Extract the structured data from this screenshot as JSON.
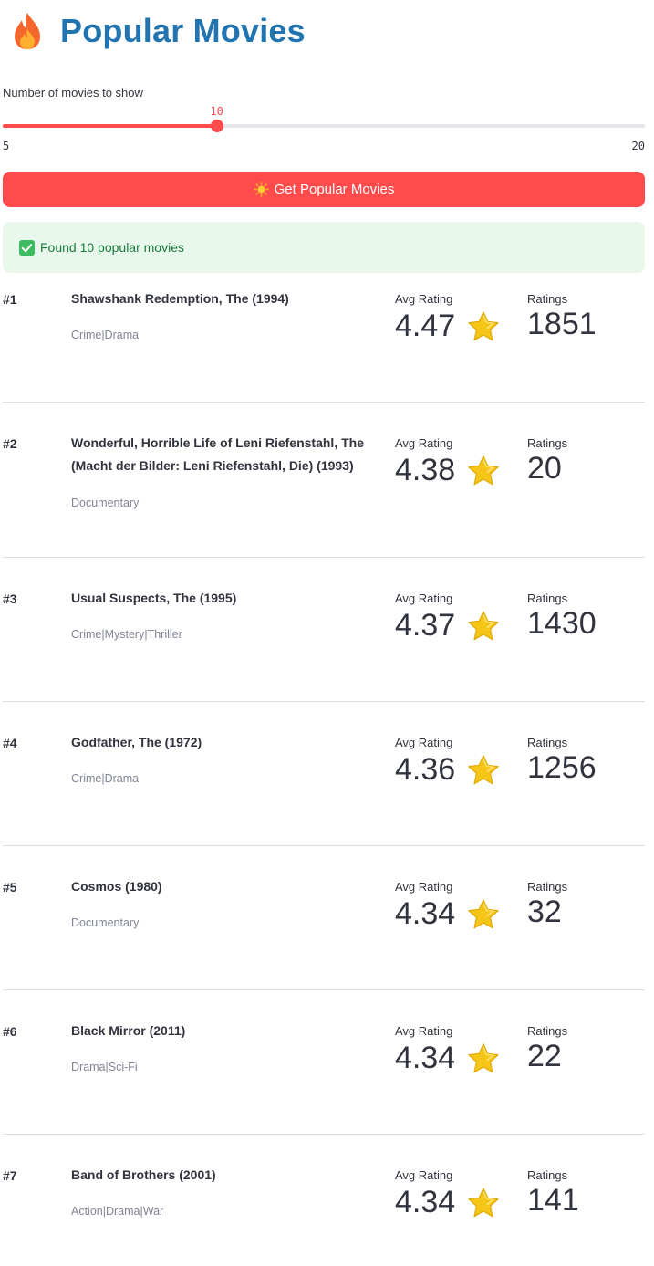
{
  "header": {
    "title": "Popular Movies",
    "icon": "fire-icon"
  },
  "slider": {
    "label": "Number of movies to show",
    "value": "10",
    "value_num": 10,
    "min": "5",
    "max": "20",
    "min_num": 5,
    "max_num": 20,
    "accent": "#ff4b4b"
  },
  "button": {
    "label": "Get Popular Movies",
    "icon": "sun-icon"
  },
  "status": {
    "message": "Found 10 popular movies",
    "icon": "check-icon"
  },
  "columns": {
    "avg_label": "Avg Rating",
    "count_label": "Ratings"
  },
  "movies": [
    {
      "rank": "#1",
      "title": "Shawshank Redemption, The (1994)",
      "genres": "Crime|Drama",
      "avg": "4.47",
      "count": "1851"
    },
    {
      "rank": "#2",
      "title": "Wonderful, Horrible Life of Leni Riefenstahl, The (Macht der Bilder: Leni Riefenstahl, Die) (1993)",
      "genres": "Documentary",
      "avg": "4.38",
      "count": "20"
    },
    {
      "rank": "#3",
      "title": "Usual Suspects, The (1995)",
      "genres": "Crime|Mystery|Thriller",
      "avg": "4.37",
      "count": "1430"
    },
    {
      "rank": "#4",
      "title": "Godfather, The (1972)",
      "genres": "Crime|Drama",
      "avg": "4.36",
      "count": "1256"
    },
    {
      "rank": "#5",
      "title": "Cosmos (1980)",
      "genres": "Documentary",
      "avg": "4.34",
      "count": "32"
    },
    {
      "rank": "#6",
      "title": "Black Mirror (2011)",
      "genres": "Drama|Sci-Fi",
      "avg": "4.34",
      "count": "22"
    },
    {
      "rank": "#7",
      "title": "Band of Brothers (2001)",
      "genres": "Action|Drama|War",
      "avg": "4.34",
      "count": "141"
    }
  ],
  "colors": {
    "title": "#2274b0",
    "accent": "#ff4b4b",
    "success_bg": "#e8f8ec",
    "success_text": "#1b7a3a",
    "star": "#f5c518"
  }
}
